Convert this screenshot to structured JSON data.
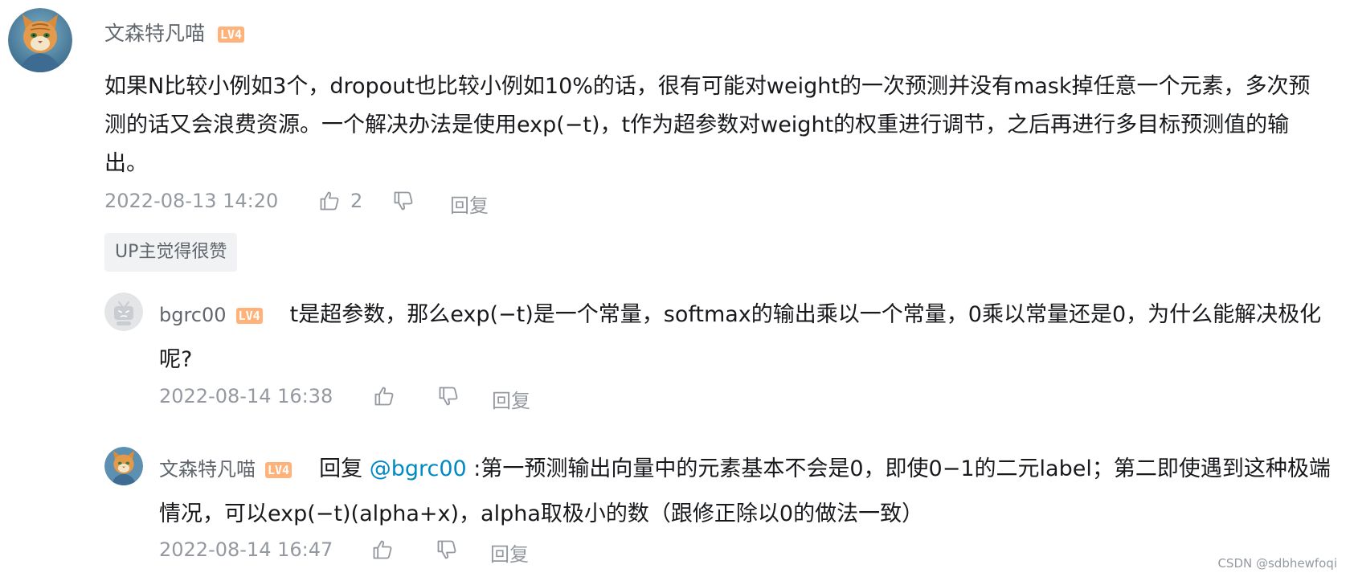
{
  "comments": [
    {
      "user": {
        "name": "文森特凡喵",
        "level": "LV4"
      },
      "content": "如果N比较小例如3个，dropout也比较小例如10%的话，很有可能对weight的一次预测并没有mask掉任意一个元素，多次预测的话又会浪费资源。一个解决办法是使用exp(−t)，t作为超参数对weight的权重进行调节，之后再进行多目标预测值的输出。",
      "time": "2022-08-13 14:20",
      "like_count": "2",
      "reply_label": "回复",
      "badge": "UP主觉得很赞",
      "replies": [
        {
          "user": {
            "name": "bgrc00",
            "level": "LV4"
          },
          "content": "t是超参数，那么exp(−t)是一个常量，softmax的输出乘以一个常量，0乘以常量还是0，为什么能解决极化呢?",
          "time": "2022-08-14 16:38",
          "reply_label": "回复"
        },
        {
          "user": {
            "name": "文森特凡喵",
            "level": "LV4"
          },
          "reply_prefix": "回复 ",
          "mention": "@bgrc00",
          "content": " :第一预测输出向量中的元素基本不会是0，即使0−1的二元label；第二即使遇到这种极端情况，可以exp(−t)(alpha+x)，alpha取极小的数（跟修正除以0的做法一致）",
          "time": "2022-08-14 16:47",
          "reply_label": "回复"
        }
      ]
    }
  ],
  "icons": {
    "like": "thumbs-up-icon",
    "dislike": "thumbs-down-icon",
    "avatar_cat": "cat-avatar-icon",
    "avatar_tv": "tv-avatar-icon"
  },
  "colors": {
    "text": "#18191c",
    "meta": "#9499a0",
    "username": "#61666d",
    "level": "#ffb37a",
    "mention": "#008ac5"
  },
  "watermark": "CSDN @sdbhewfoqi"
}
